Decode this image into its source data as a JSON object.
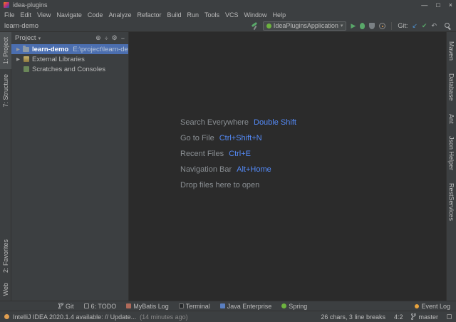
{
  "window": {
    "title": "idea-plugins"
  },
  "icons": {
    "minimize": "—",
    "maximize": "□",
    "close": "×",
    "chevron_down": "▾",
    "play": "▶",
    "check": "✔",
    "rollback": "↶",
    "update": "↙",
    "locate": "⊕",
    "collapse": "÷",
    "gear": "⚙",
    "minus": "−",
    "arrow_collapsed": "▶"
  },
  "menu": {
    "items": [
      "File",
      "Edit",
      "View",
      "Navigate",
      "Code",
      "Analyze",
      "Refactor",
      "Build",
      "Run",
      "Tools",
      "VCS",
      "Window",
      "Help"
    ]
  },
  "toolbar": {
    "breadcrumb": "learn-demo",
    "run_config": "IdeaPluginsApplication",
    "git_label": "Git:"
  },
  "left_bar": {
    "top": [
      "1: Project",
      "7: Structure"
    ],
    "bottom": [
      "2: Favorites",
      "Web"
    ]
  },
  "project_panel": {
    "header": "Project",
    "tree": [
      {
        "label": "learn-demo",
        "path": "E:\\project\\learn-demo"
      },
      {
        "label": "External Libraries",
        "path": ""
      },
      {
        "label": "Scratches and Consoles",
        "path": ""
      }
    ]
  },
  "editor": {
    "shortcuts": [
      {
        "label": "Search Everywhere",
        "keys": "Double Shift"
      },
      {
        "label": "Go to File",
        "keys": "Ctrl+Shift+N"
      },
      {
        "label": "Recent Files",
        "keys": "Ctrl+E"
      },
      {
        "label": "Navigation Bar",
        "keys": "Alt+Home"
      },
      {
        "label": "Drop files here to open",
        "keys": ""
      }
    ]
  },
  "right_bar": {
    "items": [
      "Maven",
      "Database",
      "Ant",
      "Json Helper",
      "RestServices"
    ]
  },
  "bottom_bar": {
    "items": [
      "Git",
      "6: TODO",
      "MyBatis Log",
      "Terminal",
      "Java Enterprise",
      "Spring"
    ],
    "event_log": "Event Log"
  },
  "status_bar": {
    "message": "IntelliJ IDEA 2020.1.4 available: // Update...",
    "time": "(14 minutes ago)",
    "chars": "26 chars, 3 line breaks",
    "position": "4:2",
    "branch": "master"
  }
}
